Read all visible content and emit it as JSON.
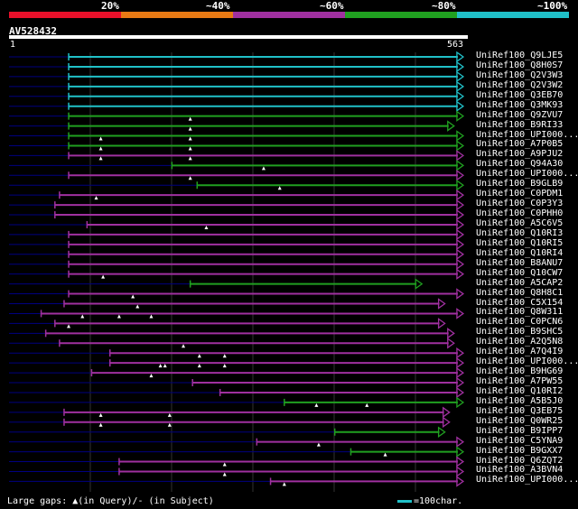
{
  "scale": {
    "segments": [
      {
        "label": "20%",
        "color": "#e8102a"
      },
      {
        "label": "~40%",
        "color": "#e87a14"
      },
      {
        "label": "~60%",
        "color": "#a030a0"
      },
      {
        "label": "~80%",
        "color": "#20a020"
      },
      {
        "label": "~100%",
        "color": "#20c0c8"
      }
    ]
  },
  "query": {
    "name": "AV528432",
    "start_label": "1",
    "end_label": "563",
    "length": 563
  },
  "colors": {
    "cyan": "#20c0c8",
    "green": "#20a020",
    "purple": "#a030a0",
    "gap": "#000080",
    "grid": "#555555"
  },
  "hits": [
    {
      "label": "UniRef100_Q9LJE5",
      "color": "cyan",
      "start": 0.13,
      "end": 0.99,
      "mark": []
    },
    {
      "label": "UniRef100_Q8H0S7",
      "color": "cyan",
      "start": 0.13,
      "end": 0.99,
      "mark": []
    },
    {
      "label": "UniRef100_Q2V3W3",
      "color": "cyan",
      "start": 0.13,
      "end": 0.99,
      "mark": []
    },
    {
      "label": "UniRef100_Q2V3W2",
      "color": "cyan",
      "start": 0.13,
      "end": 0.99,
      "mark": []
    },
    {
      "label": "UniRef100_Q3EB70",
      "color": "cyan",
      "start": 0.13,
      "end": 0.99,
      "mark": []
    },
    {
      "label": "UniRef100_Q3MK93",
      "color": "cyan",
      "start": 0.13,
      "end": 0.99,
      "mark": []
    },
    {
      "label": "UniRef100_Q9ZVU7",
      "color": "green",
      "start": 0.13,
      "end": 0.99,
      "mark": [
        0.395
      ]
    },
    {
      "label": "UniRef100_B9RI33",
      "color": "green",
      "start": 0.13,
      "end": 0.97,
      "mark": [
        0.395
      ]
    },
    {
      "label": "UniRef100_UPI000...",
      "color": "green",
      "start": 0.13,
      "end": 0.99,
      "mark": [
        0.2,
        0.395
      ]
    },
    {
      "label": "UniRef100_A7P0B5",
      "color": "green",
      "start": 0.13,
      "end": 0.99,
      "mark": [
        0.2,
        0.395
      ]
    },
    {
      "label": "UniRef100_A9PJU2",
      "color": "purple",
      "start": 0.13,
      "end": 0.99,
      "mark": [
        0.2,
        0.395
      ]
    },
    {
      "label": "UniRef100_Q94A30",
      "color": "green",
      "start": 0.355,
      "end": 0.99,
      "mark": [
        0.555
      ]
    },
    {
      "label": "UniRef100_UPI000...",
      "color": "purple",
      "start": 0.13,
      "end": 0.99,
      "mark": [
        0.395
      ]
    },
    {
      "label": "UniRef100_B9GLB9",
      "color": "green",
      "start": 0.41,
      "end": 0.99,
      "mark": [
        0.59
      ]
    },
    {
      "label": "UniRef100_C0PDM1",
      "color": "purple",
      "start": 0.11,
      "end": 0.99,
      "mark": [
        0.19
      ]
    },
    {
      "label": "UniRef100_C0P3Y3",
      "color": "purple",
      "start": 0.1,
      "end": 0.99,
      "mark": []
    },
    {
      "label": "UniRef100_C0PHH0",
      "color": "purple",
      "start": 0.1,
      "end": 0.99,
      "mark": []
    },
    {
      "label": "UniRef100_A5C6V5",
      "color": "purple",
      "start": 0.17,
      "end": 0.99,
      "mark": [
        0.43
      ]
    },
    {
      "label": "UniRef100_Q10RI3",
      "color": "purple",
      "start": 0.13,
      "end": 0.99,
      "mark": []
    },
    {
      "label": "UniRef100_Q10RI5",
      "color": "purple",
      "start": 0.13,
      "end": 0.99,
      "mark": []
    },
    {
      "label": "UniRef100_Q10RI4",
      "color": "purple",
      "start": 0.13,
      "end": 0.99,
      "mark": []
    },
    {
      "label": "UniRef100_B8ANU7",
      "color": "purple",
      "start": 0.13,
      "end": 0.99,
      "mark": []
    },
    {
      "label": "UniRef100_Q10CW7",
      "color": "purple",
      "start": 0.13,
      "end": 0.99,
      "mark": [
        0.205
      ]
    },
    {
      "label": "UniRef100_A5CAP2",
      "color": "green",
      "start": 0.395,
      "end": 0.9,
      "mark": []
    },
    {
      "label": "UniRef100_Q8H8C1",
      "color": "purple",
      "start": 0.13,
      "end": 0.99,
      "mark": [
        0.27
      ]
    },
    {
      "label": "UniRef100_C5X154",
      "color": "purple",
      "start": 0.12,
      "end": 0.95,
      "mark": [
        0.28
      ]
    },
    {
      "label": "UniRef100_Q8W311",
      "color": "purple",
      "start": 0.07,
      "end": 0.99,
      "mark": [
        0.16,
        0.24,
        0.31
      ]
    },
    {
      "label": "UniRef100_C0PCN6",
      "color": "purple",
      "start": 0.1,
      "end": 0.95,
      "mark": [
        0.13
      ]
    },
    {
      "label": "UniRef100_B9SHC5",
      "color": "purple",
      "start": 0.08,
      "end": 0.97,
      "mark": []
    },
    {
      "label": "UniRef100_A2Q5N8",
      "color": "purple",
      "start": 0.11,
      "end": 0.97,
      "mark": [
        0.38
      ]
    },
    {
      "label": "UniRef100_A7Q4I9",
      "color": "purple",
      "start": 0.22,
      "end": 0.99,
      "mark": [
        0.415,
        0.47
      ]
    },
    {
      "label": "UniRef100_UPI000...",
      "color": "purple",
      "start": 0.22,
      "end": 0.99,
      "mark": [
        0.33,
        0.34,
        0.415,
        0.47
      ]
    },
    {
      "label": "UniRef100_B9HG69",
      "color": "purple",
      "start": 0.18,
      "end": 0.99,
      "mark": [
        0.31
      ]
    },
    {
      "label": "UniRef100_A7PW55",
      "color": "purple",
      "start": 0.4,
      "end": 0.99,
      "mark": []
    },
    {
      "label": "UniRef100_Q10RI2",
      "color": "purple",
      "start": 0.46,
      "end": 0.99,
      "mark": []
    },
    {
      "label": "UniRef100_A5B5J0",
      "color": "green",
      "start": 0.6,
      "end": 0.99,
      "mark": [
        0.67,
        0.78
      ]
    },
    {
      "label": "UniRef100_Q3EB75",
      "color": "purple",
      "start": 0.12,
      "end": 0.96,
      "mark": [
        0.2,
        0.35
      ]
    },
    {
      "label": "UniRef100_Q0WR25",
      "color": "purple",
      "start": 0.12,
      "end": 0.96,
      "mark": [
        0.2,
        0.35
      ]
    },
    {
      "label": "UniRef100_B9IPP7",
      "color": "green",
      "start": 0.71,
      "end": 0.95,
      "mark": []
    },
    {
      "label": "UniRef100_C5YNA9",
      "color": "purple",
      "start": 0.54,
      "end": 0.99,
      "mark": [
        0.675
      ]
    },
    {
      "label": "UniRef100_B9GXX7",
      "color": "green",
      "start": 0.745,
      "end": 0.99,
      "mark": [
        0.82
      ]
    },
    {
      "label": "UniRef100_Q6ZQT2",
      "color": "purple",
      "start": 0.24,
      "end": 0.99,
      "mark": [
        0.47
      ]
    },
    {
      "label": "UniRef100_A3BVN4",
      "color": "purple",
      "start": 0.24,
      "end": 0.99,
      "mark": [
        0.47
      ]
    },
    {
      "label": "UniRef100_UPI000...",
      "color": "purple",
      "start": 0.57,
      "end": 0.99,
      "mark": [
        0.6
      ]
    }
  ],
  "legend": {
    "gaps": "Large gaps: ▲(in Query)/- (in Subject)",
    "scale": "=100char."
  }
}
